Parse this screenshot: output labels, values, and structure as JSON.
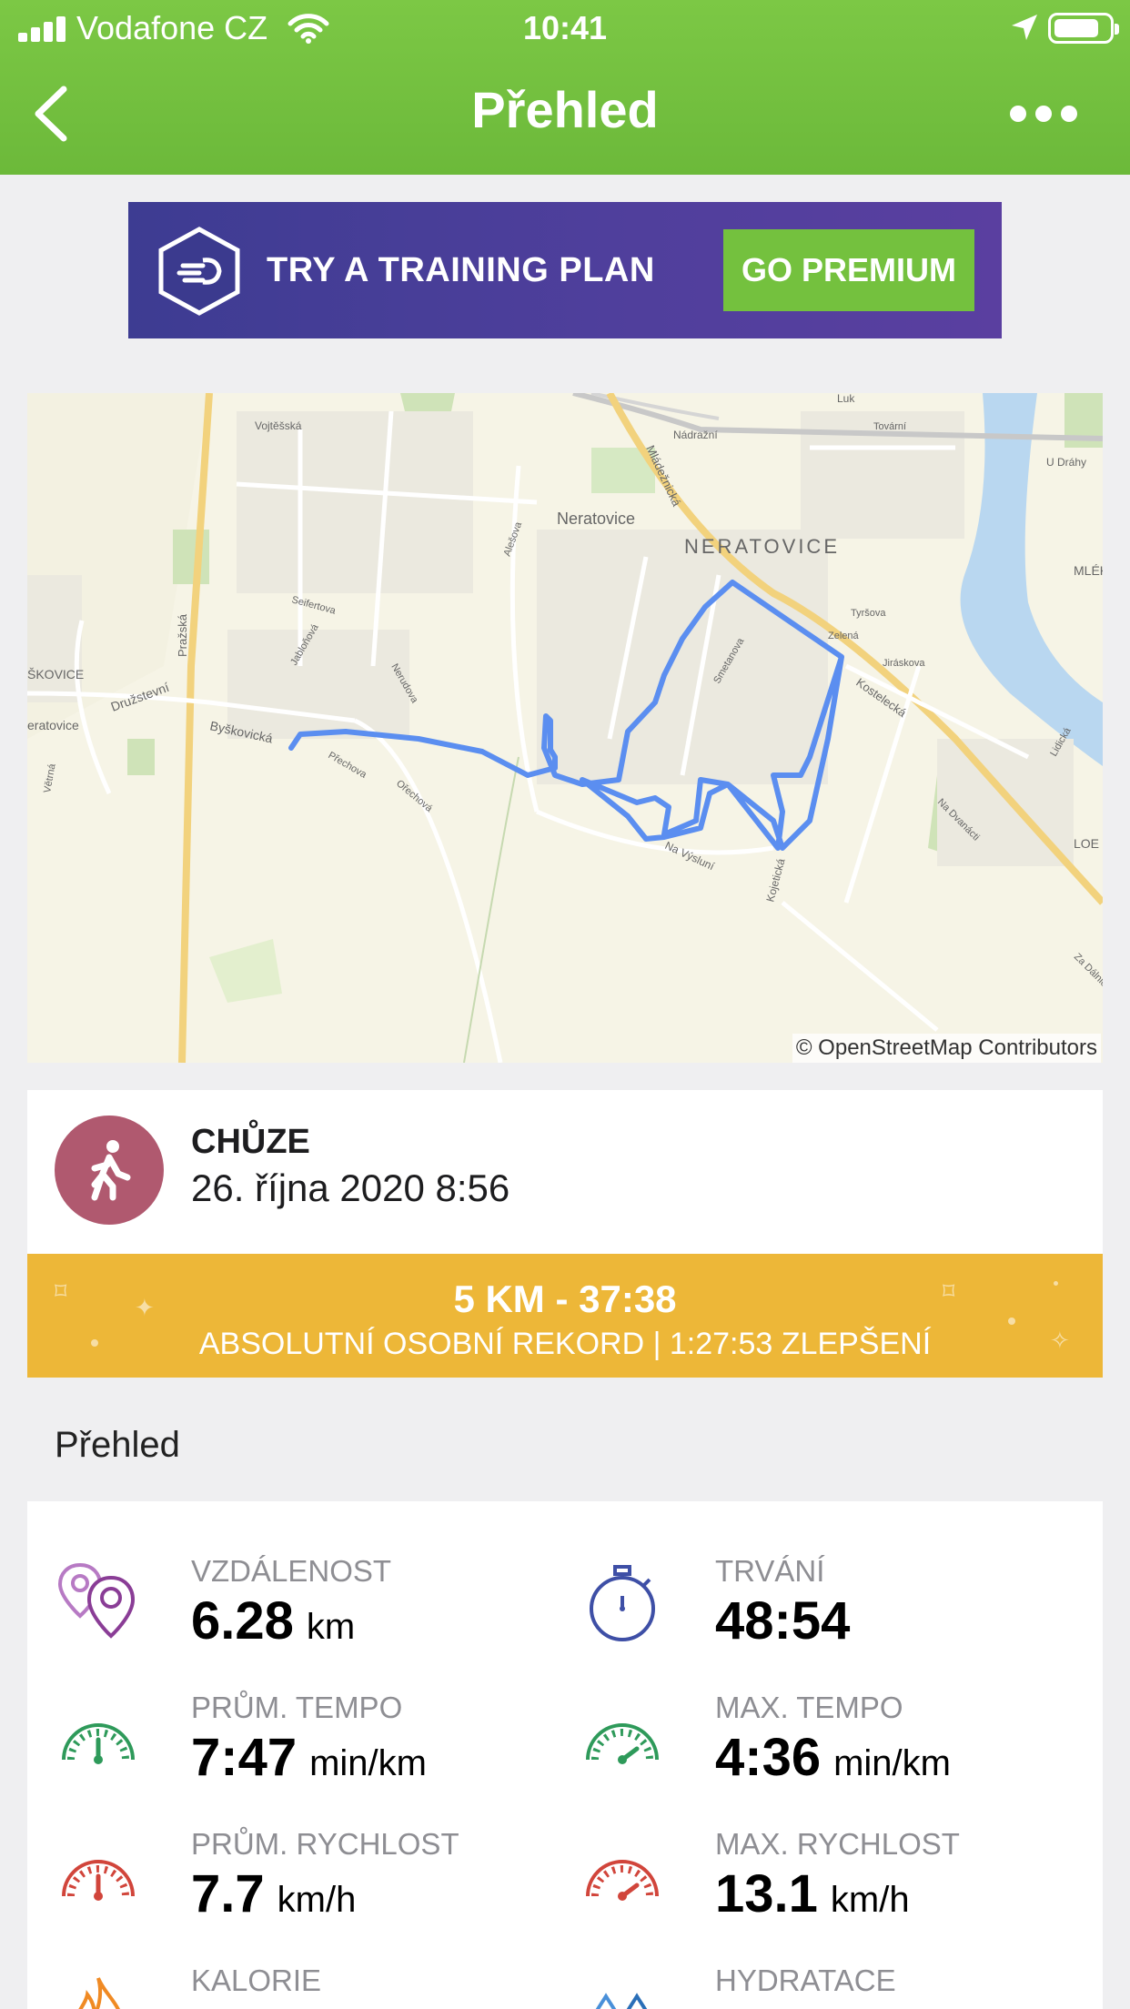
{
  "status_bar": {
    "carrier": "Vodafone CZ",
    "time": "10:41"
  },
  "nav": {
    "title": "Přehled"
  },
  "promo": {
    "text": "TRY A TRAINING PLAN",
    "button": "GO PREMIUM"
  },
  "map": {
    "credit": "© OpenStreetMap Contributors",
    "labels": {
      "neratovice_caps": "NERATOVICE",
      "neratovice": "Neratovice",
      "skovice": "ŠKOVICE",
      "eratovice": "eratovice",
      "druzstevni": "Družstevní",
      "byskovicka": "Byškovická",
      "prazska": "Pražská",
      "mladeznicka": "Mládežnická",
      "kostelecka": "Kostelecká",
      "nadrazni": "Nádražní",
      "vojtesska": "Vojtěšská",
      "u_drahy": "U Dráhy",
      "mlek": "MLÉK",
      "na_vysluni": "Na Výsluní",
      "kojeticka": "Kojetická",
      "nerudova": "Nerudova",
      "alesova": "Alešova",
      "seifertova": "Seifertova",
      "jablonova": "Jabloňová",
      "prechova": "Přechova",
      "orechova": "Ořechová",
      "vetrna": "Větrná",
      "luk": "Luk",
      "tovarni": "Tovární",
      "jiraskova": "Jiráskova",
      "zelena": "Zelená",
      "tyrsova": "Tyršova",
      "lidicka": "Lidická",
      "na_dvanacti": "Na Dvanácti",
      "za_dalnici": "Za Dálnicí",
      "smetanova": "Smetanova",
      "loe": "LOE"
    }
  },
  "activity": {
    "type": "CHŮZE",
    "date": "26. října 2020 8:56"
  },
  "record": {
    "headline": "5 KM - 37:38",
    "subline": "ABSOLUTNÍ OSOBNÍ REKORD  |  1:27:53 ZLEPŠENÍ"
  },
  "overview": {
    "title": "Přehled",
    "stats": [
      {
        "label": "VZDÁLENOST",
        "value": "6.28",
        "unit": "km",
        "icon": "distance-pins-icon"
      },
      {
        "label": "TRVÁNÍ",
        "value": "48:54",
        "unit": "",
        "icon": "stopwatch-icon"
      },
      {
        "label": "PRŮM. TEMPO",
        "value": "7:47",
        "unit": "min/km",
        "icon": "pace-gauge-icon"
      },
      {
        "label": "MAX. TEMPO",
        "value": "4:36",
        "unit": "min/km",
        "icon": "pace-gauge-icon"
      },
      {
        "label": "PRŮM. RYCHLOST",
        "value": "7.7",
        "unit": "km/h",
        "icon": "speed-gauge-icon"
      },
      {
        "label": "MAX. RYCHLOST",
        "value": "13.1",
        "unit": "km/h",
        "icon": "speed-gauge-icon"
      },
      {
        "label": "KALORIE",
        "value": "",
        "unit": "",
        "icon": "flame-icon"
      },
      {
        "label": "HYDRATACE",
        "value": "",
        "unit": "",
        "icon": "water-drops-icon"
      }
    ]
  },
  "colors": {
    "header_green": "#74c13e",
    "promo_purple": "#4a3e98",
    "record_gold": "#edb738",
    "route_blue": "#5b8ef0",
    "activity_avatar": "#b0596f"
  }
}
